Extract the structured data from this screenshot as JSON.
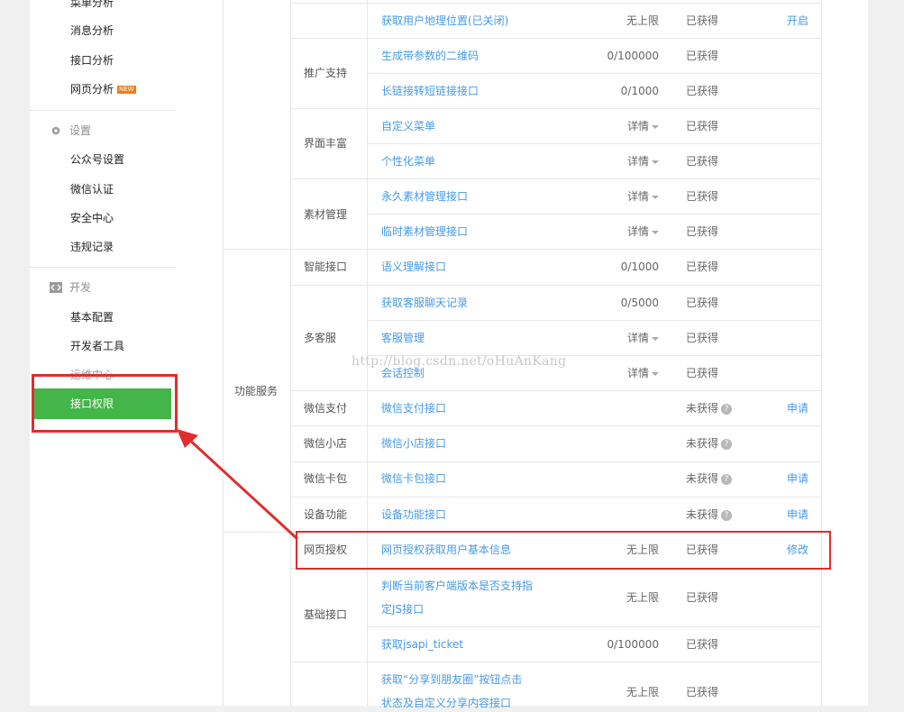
{
  "sidebar": {
    "top_items": [
      "菜单分析",
      "消息分析",
      "接口分析",
      "网页分析"
    ],
    "new_badge": "NEW",
    "settings": {
      "label": "设置",
      "items": [
        "公众号设置",
        "微信认证",
        "安全中心",
        "违规记录"
      ]
    },
    "dev": {
      "label": "开发",
      "items": [
        "基本配置",
        "开发者工具",
        "运维中心"
      ],
      "active": "接口权限"
    }
  },
  "table": {
    "rows": {
      "r0": {
        "name": "获取用户地理位置(已关闭)",
        "limit": "无上限",
        "status": "已获得",
        "op": "开启"
      },
      "c1": "推广支持",
      "r1": {
        "name": "生成带参数的二维码",
        "limit": "0/100000",
        "status": "已获得"
      },
      "r2": {
        "name": "长链接转短链接接口",
        "limit": "0/1000",
        "status": "已获得"
      },
      "c2": "界面丰富",
      "r3": {
        "name": "自定义菜单",
        "limit": "详情",
        "status": "已获得"
      },
      "r4": {
        "name": "个性化菜单",
        "limit": "详情",
        "status": "已获得"
      },
      "c3": "素材管理",
      "r5": {
        "name": "永久素材管理接口",
        "limit": "详情",
        "status": "已获得"
      },
      "r6": {
        "name": "临时素材管理接口",
        "limit": "详情",
        "status": "已获得"
      },
      "group1": "功能服务",
      "c4": "智能接口",
      "r7": {
        "name": "语义理解接口",
        "limit": "0/1000",
        "status": "已获得"
      },
      "c5": "多客服",
      "r8": {
        "name": "获取客服聊天记录",
        "limit": "0/5000",
        "status": "已获得"
      },
      "r9": {
        "name": "客服管理",
        "limit": "详情",
        "status": "已获得"
      },
      "r10": {
        "name": "会话控制",
        "limit": "详情",
        "status": "已获得"
      },
      "c6": "微信支付",
      "r11": {
        "name": "微信支付接口",
        "status": "未获得",
        "op": "申请"
      },
      "c7": "微信小店",
      "r12": {
        "name": "微信小店接口",
        "status": "未获得"
      },
      "c8": "微信卡包",
      "r13": {
        "name": "微信卡包接口",
        "status": "未获得",
        "op": "申请"
      },
      "c9": "设备功能",
      "r14": {
        "name": "设备功能接口",
        "status": "未获得",
        "op": "申请"
      },
      "c10": "网页授权",
      "r15": {
        "name": "网页授权获取用户基本信息",
        "limit": "无上限",
        "status": "已获得",
        "op": "修改"
      },
      "c11": "基础接口",
      "r16": {
        "name1": "判断当前客户端版本是否支持指",
        "name2": "定JS接口",
        "limit": "无上限",
        "status": "已获得"
      },
      "r17": {
        "name": "获取jsapi_ticket",
        "limit": "0/100000",
        "status": "已获得"
      },
      "r18": {
        "name1": "获取“分享到朋友圈”按钮点击",
        "name2": "状态及自定义分享内容接口",
        "limit": "无上限",
        "status": "已获得"
      }
    }
  },
  "watermark": "http://blog.csdn.net/oHuAnKang",
  "colors": {
    "accent": "#44b549",
    "link": "#459ae9",
    "annotation": "#e02d2d"
  }
}
